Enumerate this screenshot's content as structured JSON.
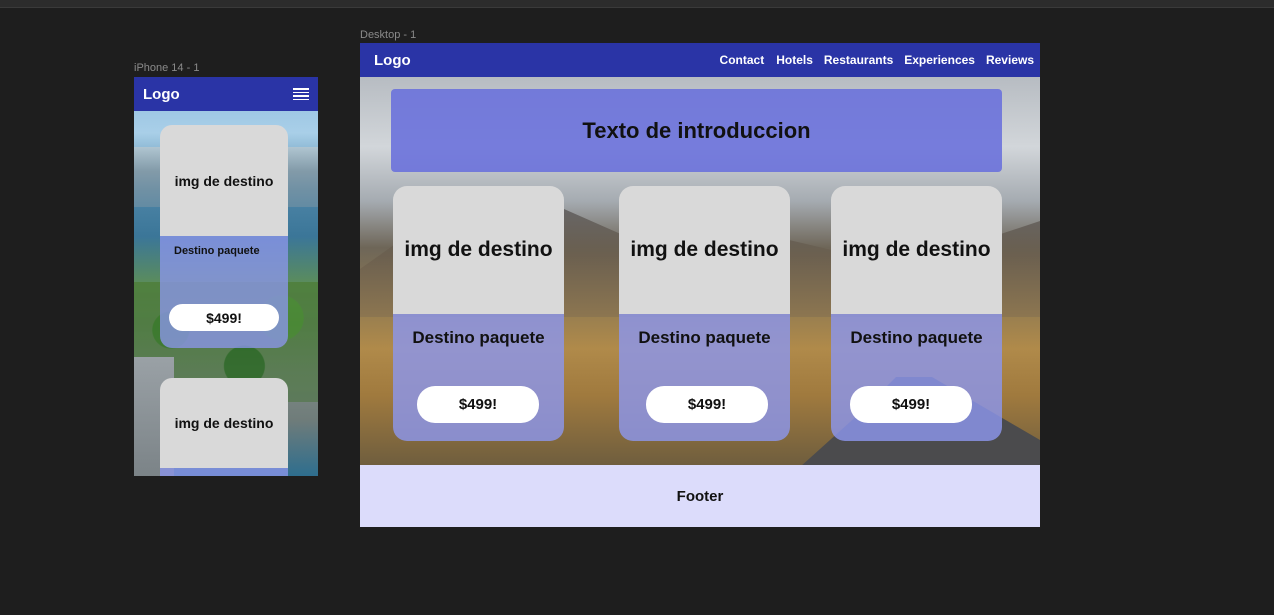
{
  "frames": {
    "mobile_label": "iPhone 14 - 1",
    "desktop_label": "Desktop - 1"
  },
  "mobile": {
    "logo": "Logo",
    "menu_icon": "hamburger-menu-icon",
    "cards": [
      {
        "image_text": "img de destino",
        "title": "Destino paquete",
        "price": "$499!"
      },
      {
        "image_text": "img de destino"
      }
    ]
  },
  "desktop": {
    "logo": "Logo",
    "nav": [
      "Contact",
      "Hotels",
      "Restaurants",
      "Experiences",
      "Reviews"
    ],
    "intro": "Texto de introduccion",
    "cards": [
      {
        "image_text": "img de destino",
        "title": "Destino paquete",
        "price": "$499!"
      },
      {
        "image_text": "img de destino",
        "title": "Destino paquete",
        "price": "$499!"
      },
      {
        "image_text": "img de destino",
        "title": "Destino paquete",
        "price": "$499!"
      }
    ],
    "footer": "Footer"
  },
  "colors": {
    "canvas": "#1e1e1e",
    "nav": "#2a34a6",
    "card_body": "#8c96eb",
    "image_placeholder": "#d9d9d9",
    "footer": "#dcdcfb"
  }
}
